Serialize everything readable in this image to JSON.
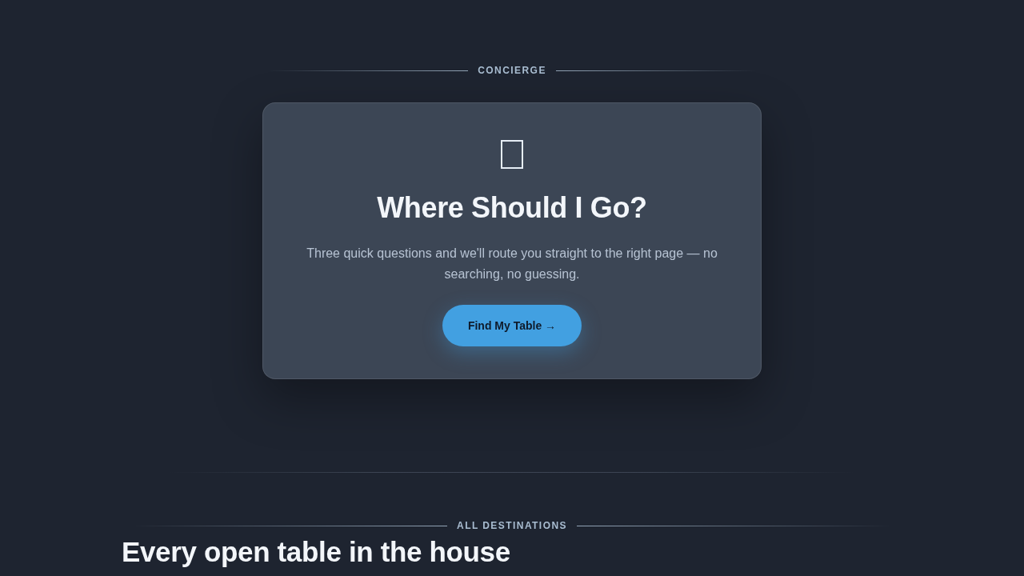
{
  "concierge": {
    "eyebrow": "CONCIERGE",
    "title": "Where Should I Go?",
    "description": "Three quick questions and we'll route you straight to the right page — no searching, no guessing.",
    "button": "Find My Table →"
  },
  "destinations": {
    "eyebrow": "ALL DESTINATIONS",
    "title": "Every open table in the house"
  }
}
